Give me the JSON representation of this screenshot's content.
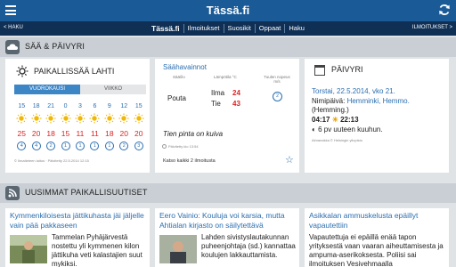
{
  "app": {
    "title": "Tässä.fi"
  },
  "nav": {
    "back": "< HAKU",
    "forward": "ILMOITUKSET >",
    "tabs": [
      "Tässä.fi",
      "Ilmoitukset",
      "Suosikit",
      "Oppaat",
      "Haku"
    ]
  },
  "weather_section": {
    "title": "SÄÄ & PÄIVYRI"
  },
  "weather": {
    "title": "PAIKALLISSÄÄ LAHTI",
    "tabs": [
      "VUOROKAUSI",
      "VIIKKO"
    ],
    "times": [
      "15",
      "18",
      "21",
      "0",
      "3",
      "6",
      "9",
      "12",
      "15"
    ],
    "temps": [
      "25",
      "20",
      "18",
      "15",
      "11",
      "11",
      "18",
      "20",
      "20"
    ],
    "wind": [
      "4",
      "4",
      "2",
      "1",
      "1",
      "1",
      "1",
      "2",
      "3"
    ],
    "source": "© Ilmatieteen laitos · Päivitetty 22.5.2014 12:15"
  },
  "observations": {
    "title": "Säähavainnot",
    "col1": "Sää/ilo",
    "col2": "Lämpötila °C",
    "col3": "Tuulen nopeus m/s",
    "condition": "Pouta",
    "air_label": "Ilma",
    "air_value": "24",
    "road_label": "Tie",
    "road_value": "43",
    "wind": "2",
    "road_status": "Tien pinta on kuiva",
    "updated": "Päivitetty klo 13:54",
    "see_all": "Katso kaikki 2 ilmoitusta"
  },
  "day": {
    "title": "PÄIVYRI",
    "date": "Torstai, 22.5.2014, vko 21.",
    "names_label": "Nimipäivä:",
    "names": "Hemminki, Hemmo.",
    "names_extra": "(Hemming.)",
    "sunrise": "04:17",
    "sunset": "22:13",
    "moon": "6 pv uuteen kuuhun.",
    "source": "Almanakka © Helsingin yliopisto"
  },
  "news_section": {
    "title": "UUSIMMAT PAIKALLISUUTISET"
  },
  "news": [
    {
      "title": "Kymmenkiloisesta jättikuhasta jäi jäljelle vain pää pakkaseen",
      "text": "Tammelan Pyhäjärvestä nostettu yli kymmenen kilon jättikuha veti kalastajien suut mykiksi."
    },
    {
      "title": "Eero Vainio: Kouluja voi karsia, mutta Ahtialan kirjasto on säilytettävä",
      "text": "Lahden sivistyslautakunnan puheenjohtaja (sd.) kannattaa koulujen lakkauttamista."
    },
    {
      "title": "Asikkalan ammuskelusta epäillyt vapautettiin",
      "text": "Vapautettuja ei epäillä enää tapon yrityksestä vaan vaaran aiheuttamisesta ja ampuma-aserikoksesta. Poliisi sai ilmoituksen Vesivehmaalla"
    }
  ]
}
